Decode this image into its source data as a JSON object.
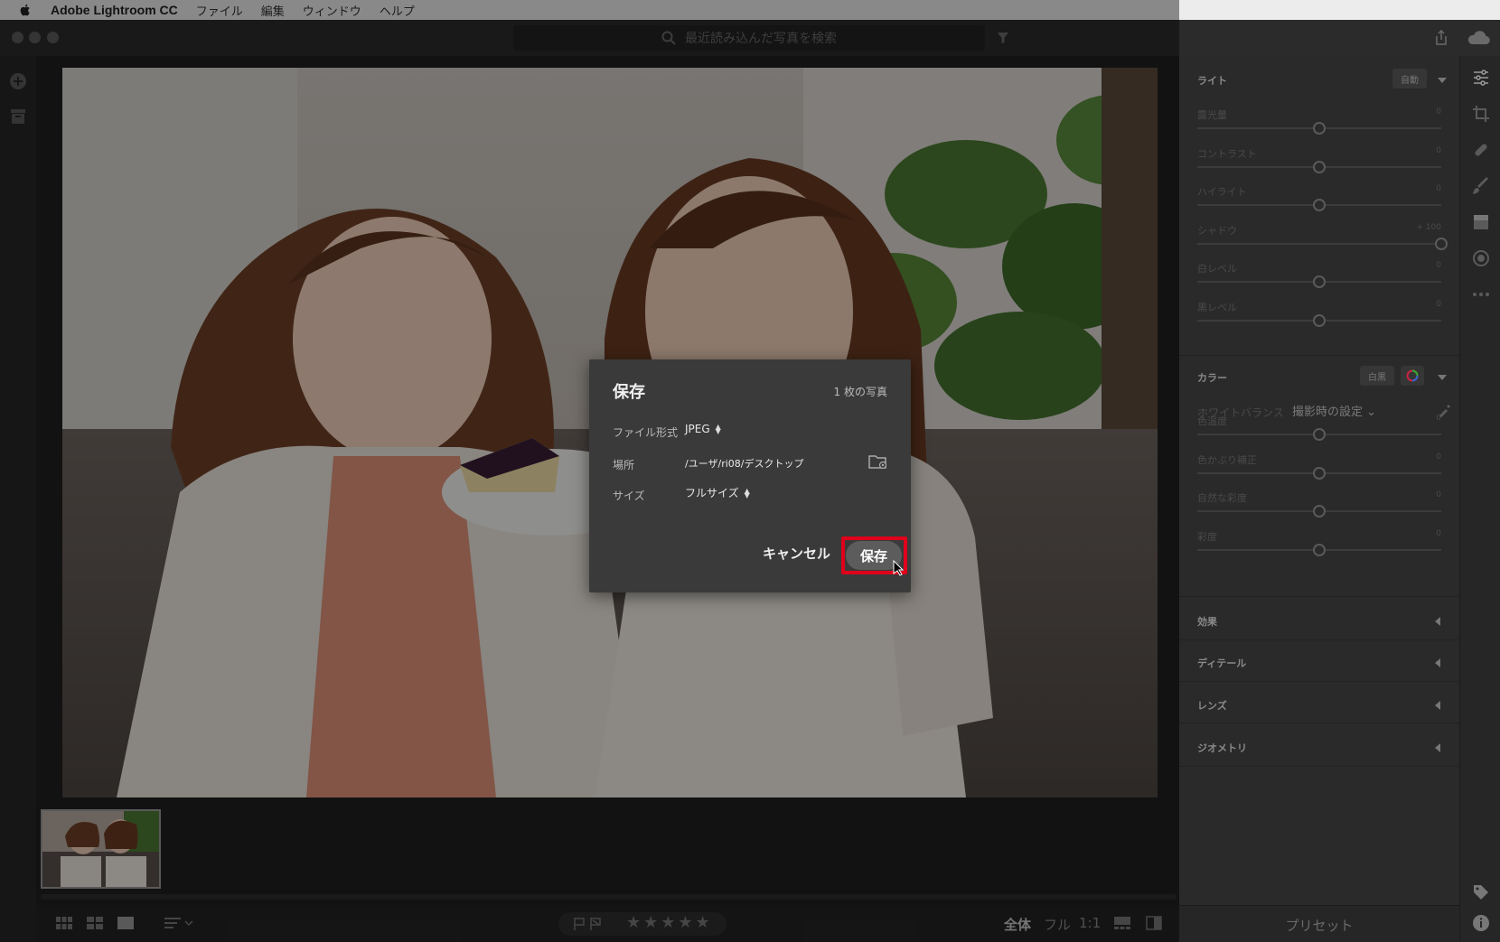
{
  "menubar": {
    "app_name": "Adobe Lightroom CC",
    "items": [
      "ファイル",
      "編集",
      "ウィンドウ",
      "ヘルプ"
    ]
  },
  "search": {
    "placeholder": "最近読み込んだ写真を検索"
  },
  "right_panel": {
    "light": {
      "title": "ライト",
      "auto_label": "自動",
      "sliders": [
        {
          "label": "露光量",
          "value": "0",
          "fraction": 0.5
        },
        {
          "label": "コントラスト",
          "value": "0",
          "fraction": 0.5
        },
        {
          "label": "ハイライト",
          "value": "0",
          "fraction": 0.5
        },
        {
          "label": "シャドウ",
          "value": "+ 100",
          "fraction": 1.0
        },
        {
          "label": "白レベル",
          "value": "0",
          "fraction": 0.5
        },
        {
          "label": "黒レベル",
          "value": "0",
          "fraction": 0.5
        }
      ]
    },
    "color": {
      "title": "カラー",
      "bw_label": "白黒",
      "wb_label": "ホワイトバランス",
      "wb_value": "撮影時の設定",
      "sliders": [
        {
          "label": "色温度",
          "value": "0",
          "fraction": 0.5
        },
        {
          "label": "色かぶり補正",
          "value": "0",
          "fraction": 0.5
        },
        {
          "label": "自然な彩度",
          "value": "0",
          "fraction": 0.5
        },
        {
          "label": "彩度",
          "value": "0",
          "fraction": 0.5
        }
      ]
    },
    "collapsed_sections": [
      "効果",
      "ディテール",
      "レンズ",
      "ジオメトリ"
    ],
    "presets_label": "プリセット"
  },
  "bottombar": {
    "stars": "★★★★★",
    "zoom_options": [
      "全体",
      "フル",
      "1:1"
    ]
  },
  "dialog": {
    "title": "保存",
    "count": "1 枚の写真",
    "format_label": "ファイル形式",
    "format_value": "JPEG",
    "location_label": "場所",
    "location_value": "/ユーザ/ri08/デスクトップ",
    "size_label": "サイズ",
    "size_value": "フルサイズ",
    "cancel_label": "キャンセル",
    "save_label": "保存"
  },
  "colors": {
    "highlight_outline": "#e0001b",
    "panel_bg": "#2a2a2a",
    "dialog_bg": "#3a3a3a"
  }
}
